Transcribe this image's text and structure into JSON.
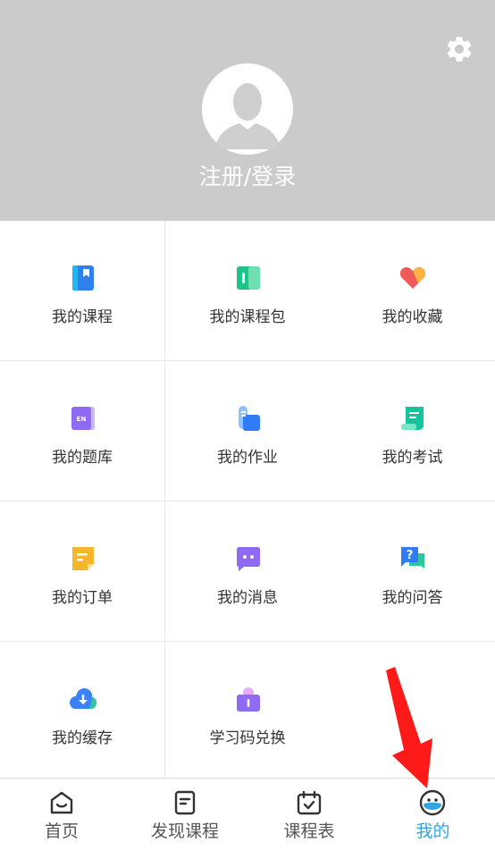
{
  "profile": {
    "login_label": "注册/登录",
    "settings_icon": "gear-icon",
    "avatar_icon": "default-avatar-icon"
  },
  "menu": [
    {
      "label": "我的课程",
      "icon": "book-icon",
      "color": "#2f80ed"
    },
    {
      "label": "我的课程包",
      "icon": "course-package-icon",
      "color": "#1dc48a"
    },
    {
      "label": "我的收藏",
      "icon": "favorite-heart-icon",
      "color": "#f05a5a"
    },
    {
      "label": "我的题库",
      "icon": "question-bank-icon",
      "color": "#8e6bf2"
    },
    {
      "label": "我的作业",
      "icon": "homework-icon",
      "color": "#3b82f6"
    },
    {
      "label": "我的考试",
      "icon": "exam-scroll-icon",
      "color": "#14c49a"
    },
    {
      "label": "我的订单",
      "icon": "order-note-icon",
      "color": "#f7b52c"
    },
    {
      "label": "我的消息",
      "icon": "message-bubble-icon",
      "color": "#8e6bf2"
    },
    {
      "label": "我的问答",
      "icon": "qa-bubble-icon",
      "color": "#2f7cf6"
    },
    {
      "label": "我的缓存",
      "icon": "cloud-download-icon",
      "color": "#3b82f6"
    },
    {
      "label": "学习码兑换",
      "icon": "study-code-icon",
      "color": "#8e6bf2"
    }
  ],
  "tabs": [
    {
      "label": "首页",
      "icon": "home-icon",
      "active": false
    },
    {
      "label": "发现课程",
      "icon": "discover-courses-icon",
      "active": false
    },
    {
      "label": "课程表",
      "icon": "calendar-icon",
      "active": false
    },
    {
      "label": "我的",
      "icon": "mine-smiley-icon",
      "active": true
    }
  ],
  "colors": {
    "header_bg": "#cbcbcb",
    "active_tab": "#2ea6e6",
    "annotation_arrow": "#ff1a1a"
  }
}
